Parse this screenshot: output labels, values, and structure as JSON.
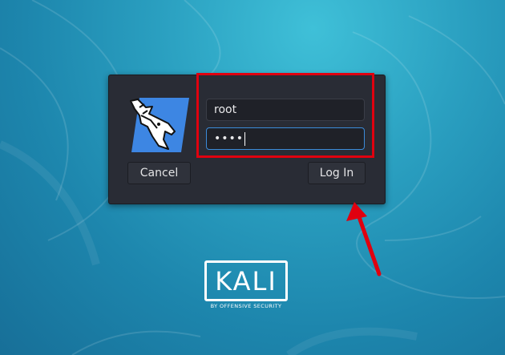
{
  "login_form": {
    "username_value": "root",
    "password_value": "••••",
    "cancel_label": "Cancel",
    "login_label": "Log In"
  },
  "branding": {
    "wordmark": "KALI",
    "tagline": "BY OFFENSIVE SECURITY"
  },
  "icons": {
    "dragon_logo": "kali-dragon-icon",
    "annotation_arrow": "arrow-up-icon"
  },
  "colors": {
    "panel": "#292c35",
    "field_background": "#1f2128",
    "focus_border": "#3b8bd9",
    "logo_blue": "#3d86e3",
    "highlight_red": "#e0000f",
    "desktop_teal": "#2a9fc0"
  }
}
